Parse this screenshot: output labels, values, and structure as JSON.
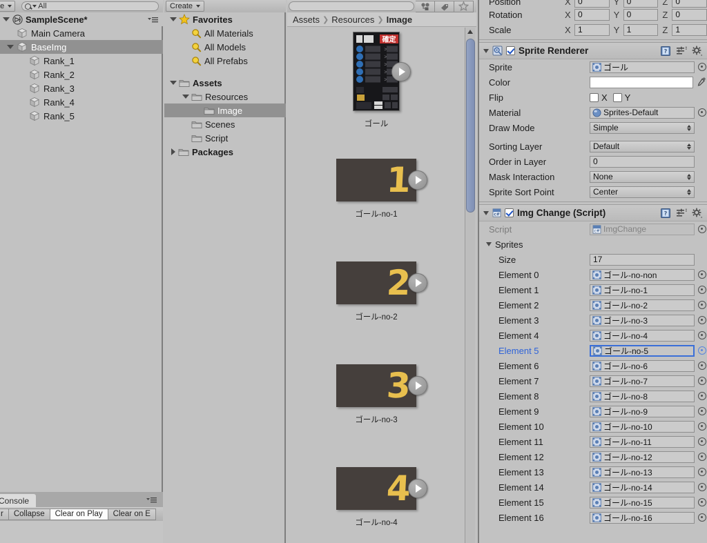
{
  "hierarchy": {
    "toolbar": {
      "create_label": "ate",
      "search_value": "All"
    },
    "scene_name": "SampleScene*",
    "items": [
      {
        "label": "Main Camera",
        "depth": 1,
        "selected": false,
        "expandable": false
      },
      {
        "label": "BaseImg",
        "depth": 1,
        "selected": true,
        "expandable": true
      },
      {
        "label": "Rank_1",
        "depth": 2,
        "selected": false,
        "expandable": false
      },
      {
        "label": "Rank_2",
        "depth": 2,
        "selected": false,
        "expandable": false
      },
      {
        "label": "Rank_3",
        "depth": 2,
        "selected": false,
        "expandable": false
      },
      {
        "label": "Rank_4",
        "depth": 2,
        "selected": false,
        "expandable": false
      },
      {
        "label": "Rank_5",
        "depth": 2,
        "selected": false,
        "expandable": false
      }
    ]
  },
  "console": {
    "tab_label": "Console",
    "buttons": [
      {
        "label": "r",
        "active": false
      },
      {
        "label": "Collapse",
        "active": false
      },
      {
        "label": "Clear on Play",
        "active": true
      },
      {
        "label": "Clear on E",
        "active": false
      }
    ]
  },
  "project_tree": {
    "create_label": "Create",
    "rows": [
      {
        "label": "Favorites",
        "depth": 0,
        "icon": "star-icon",
        "bold": true,
        "expanded": true,
        "selected": false
      },
      {
        "label": "All Materials",
        "depth": 1,
        "icon": "search-lens-icon",
        "bold": false,
        "expanded": null,
        "selected": false
      },
      {
        "label": "All Models",
        "depth": 1,
        "icon": "search-lens-icon",
        "bold": false,
        "expanded": null,
        "selected": false
      },
      {
        "label": "All Prefabs",
        "depth": 1,
        "icon": "search-lens-icon",
        "bold": false,
        "expanded": null,
        "selected": false
      },
      {
        "label": "Assets",
        "depth": 0,
        "icon": "folder-icon",
        "bold": true,
        "expanded": true,
        "selected": false
      },
      {
        "label": "Resources",
        "depth": 1,
        "icon": "folder-icon",
        "bold": false,
        "expanded": true,
        "selected": false
      },
      {
        "label": "Image",
        "depth": 2,
        "icon": "folder-icon",
        "bold": false,
        "expanded": null,
        "selected": true
      },
      {
        "label": "Scenes",
        "depth": 1,
        "icon": "folder-icon",
        "bold": false,
        "expanded": null,
        "selected": false
      },
      {
        "label": "Script",
        "depth": 1,
        "icon": "folder-icon",
        "bold": false,
        "expanded": null,
        "selected": false
      },
      {
        "label": "Packages",
        "depth": 0,
        "icon": "folder-icon",
        "bold": true,
        "expanded": false,
        "selected": false
      }
    ]
  },
  "assets": {
    "breadcrumb": [
      "Assets",
      "Resources",
      "Image"
    ],
    "filter_icons": [
      "type-filter-icon",
      "label-filter-icon",
      "favorite-star-icon"
    ],
    "tiles": [
      {
        "label": "ゴール",
        "kind": "ui-sprite",
        "number": ""
      },
      {
        "label": "ゴール-no-1",
        "kind": "number",
        "number": "1"
      },
      {
        "label": "ゴール-no-2",
        "kind": "number",
        "number": "2"
      },
      {
        "label": "ゴール-no-3",
        "kind": "number",
        "number": "3"
      },
      {
        "label": "ゴール-no-4",
        "kind": "number",
        "number": "4"
      }
    ],
    "ui_sprite": {
      "confirm_label": "確定",
      "round_label": "10",
      "round_suffix": "R",
      "day_label": "日¦本",
      "rank_labels": [
        "I",
        "II",
        "III",
        "IV",
        "V"
      ],
      "bottom_labels": [
        "ダート",
        "4F",
        "3F",
        "タイム"
      ]
    }
  },
  "inspector": {
    "transform": {
      "rows": [
        {
          "label": "Position",
          "x": "0",
          "y": "0",
          "z": "0"
        },
        {
          "label": "Rotation",
          "x": "0",
          "y": "0",
          "z": "0"
        },
        {
          "label": "Scale",
          "x": "1",
          "y": "1",
          "z": "1"
        }
      ],
      "axes": [
        "X",
        "Y",
        "Z"
      ]
    },
    "sprite_renderer": {
      "title": "Sprite Renderer",
      "enabled": true,
      "icon": "sprite-renderer-icon",
      "fields": [
        {
          "label": "Sprite",
          "value": "ゴール",
          "type": "object",
          "icon": "sprite-icon"
        },
        {
          "label": "Color",
          "value": "",
          "type": "color"
        },
        {
          "label": "Flip",
          "value": "",
          "type": "flip",
          "x_label": "X",
          "y_label": "Y"
        },
        {
          "label": "Material",
          "value": "Sprites-Default",
          "type": "object",
          "icon": "material-sphere-icon"
        },
        {
          "label": "Draw Mode",
          "value": "Simple",
          "type": "dropdown"
        },
        {
          "label": "Sorting Layer",
          "value": "Default",
          "type": "dropdown"
        },
        {
          "label": "Order in Layer",
          "value": "0",
          "type": "text"
        },
        {
          "label": "Mask Interaction",
          "value": "None",
          "type": "dropdown"
        },
        {
          "label": "Sprite Sort Point",
          "value": "Center",
          "type": "dropdown"
        }
      ]
    },
    "img_change": {
      "title": "Img Change (Script)",
      "enabled": true,
      "icon": "csharp-script-icon",
      "script_label": "Script",
      "script_value": "ImgChange",
      "sprites_label": "Sprites",
      "size_label": "Size",
      "size_value": "17",
      "elements": [
        {
          "label": "Element 0",
          "value": "ゴール-no-non",
          "selected": false
        },
        {
          "label": "Element 1",
          "value": "ゴール-no-1",
          "selected": false
        },
        {
          "label": "Element 2",
          "value": "ゴール-no-2",
          "selected": false
        },
        {
          "label": "Element 3",
          "value": "ゴール-no-3",
          "selected": false
        },
        {
          "label": "Element 4",
          "value": "ゴール-no-4",
          "selected": false
        },
        {
          "label": "Element 5",
          "value": "ゴール-no-5",
          "selected": true
        },
        {
          "label": "Element 6",
          "value": "ゴール-no-6",
          "selected": false
        },
        {
          "label": "Element 7",
          "value": "ゴール-no-7",
          "selected": false
        },
        {
          "label": "Element 8",
          "value": "ゴール-no-8",
          "selected": false
        },
        {
          "label": "Element 9",
          "value": "ゴール-no-9",
          "selected": false
        },
        {
          "label": "Element 10",
          "value": "ゴール-no-10",
          "selected": false
        },
        {
          "label": "Element 11",
          "value": "ゴール-no-11",
          "selected": false
        },
        {
          "label": "Element 12",
          "value": "ゴール-no-12",
          "selected": false
        },
        {
          "label": "Element 13",
          "value": "ゴール-no-13",
          "selected": false
        },
        {
          "label": "Element 14",
          "value": "ゴール-no-14",
          "selected": false
        },
        {
          "label": "Element 15",
          "value": "ゴール-no-15",
          "selected": false
        },
        {
          "label": "Element 16",
          "value": "ゴール-no-16",
          "selected": false
        }
      ]
    },
    "header_icons": [
      "help-book-icon",
      "preset-icon",
      "settings-gear-icon"
    ]
  },
  "colors": {
    "panel_bg": "#c2c2c2",
    "selection": "#919191",
    "accent_blue": "#2f63d8",
    "focus_border": "#3a6fd8",
    "thumb_bg": "#453f3c",
    "number_yellow": "#e8bf4e",
    "scrollbar": "#8493b8"
  }
}
